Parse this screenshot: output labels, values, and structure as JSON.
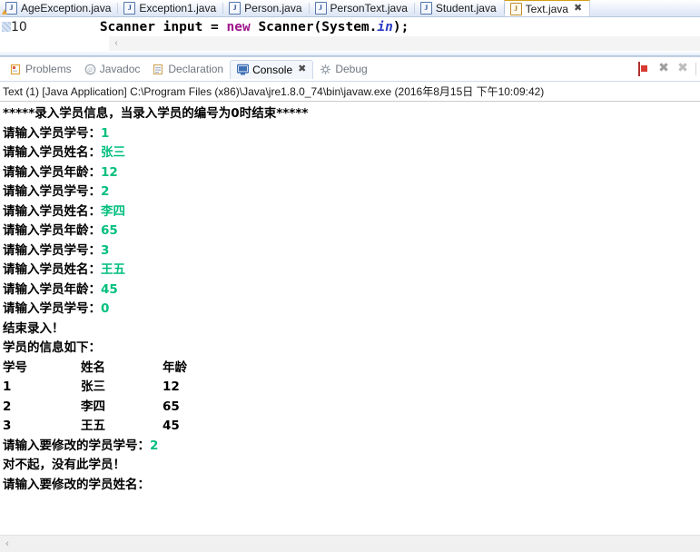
{
  "editor": {
    "tabs": [
      {
        "label": "AgeException.java",
        "icon": "java-file-warning-icon",
        "active": false,
        "warning": true
      },
      {
        "label": "Exception1.java",
        "icon": "java-file-icon",
        "active": false,
        "warning": false
      },
      {
        "label": "Person.java",
        "icon": "java-file-icon",
        "active": false,
        "warning": false
      },
      {
        "label": "PersonText.java",
        "icon": "java-file-icon",
        "active": false,
        "warning": false
      },
      {
        "label": "Student.java",
        "icon": "java-file-icon",
        "active": false,
        "warning": false
      },
      {
        "label": "Text.java",
        "icon": "java-file-icon",
        "active": true,
        "warning": false
      }
    ],
    "close_glyph": "✖",
    "line_number": "10",
    "code": {
      "indent": "",
      "part1": "Scanner input = ",
      "keyword": "new",
      "part2": " Scanner(System.",
      "field": "in",
      "part3": ");"
    }
  },
  "view_tabs": [
    {
      "label": "Problems",
      "icon": "problems-icon",
      "active": false
    },
    {
      "label": "Javadoc",
      "icon": "javadoc-icon",
      "active": false
    },
    {
      "label": "Declaration",
      "icon": "declaration-icon",
      "active": false
    },
    {
      "label": "Console",
      "icon": "console-icon",
      "active": true
    },
    {
      "label": "Debug",
      "icon": "debug-icon",
      "active": false
    }
  ],
  "view_tab_close_glyph": "✖",
  "toolbar": {
    "terminate_label": "terminate-button",
    "remove_label": "✖",
    "remove_all_label": "✖"
  },
  "console": {
    "header": "Text (1) [Java Application] C:\\Program Files (x86)\\Java\\jre1.8.0_74\\bin\\javaw.exe (2016年8月15日 下午10:09:42)",
    "lines": [
      {
        "type": "plain",
        "text": "*****录入学员信息，当录入学员的编号为0时结束*****"
      },
      {
        "type": "prompt",
        "text": "请输入学员学号：",
        "value": "1"
      },
      {
        "type": "prompt",
        "text": "请输入学员姓名：",
        "value": "张三"
      },
      {
        "type": "prompt",
        "text": "请输入学员年龄：",
        "value": "12"
      },
      {
        "type": "prompt",
        "text": "请输入学员学号：",
        "value": "2"
      },
      {
        "type": "prompt",
        "text": "请输入学员姓名：",
        "value": "李四"
      },
      {
        "type": "prompt",
        "text": "请输入学员年龄：",
        "value": "65"
      },
      {
        "type": "prompt",
        "text": "请输入学员学号：",
        "value": "3"
      },
      {
        "type": "prompt",
        "text": "请输入学员姓名：",
        "value": "王五"
      },
      {
        "type": "prompt",
        "text": "请输入学员年龄：",
        "value": "45"
      },
      {
        "type": "prompt",
        "text": "请输入学员学号：",
        "value": "0"
      },
      {
        "type": "plain",
        "text": "结束录入！"
      },
      {
        "type": "plain",
        "text": "学员的信息如下："
      },
      {
        "type": "row",
        "c1": "学号",
        "c2": "姓名",
        "c3": "年龄"
      },
      {
        "type": "row",
        "c1": "1",
        "c2": "张三",
        "c3": "12"
      },
      {
        "type": "row",
        "c1": "2",
        "c2": "李四",
        "c3": "65"
      },
      {
        "type": "row",
        "c1": "3",
        "c2": "王五",
        "c3": "45"
      },
      {
        "type": "prompt",
        "text": "请输入要修改的学员学号：",
        "value": "2"
      },
      {
        "type": "plain",
        "text": "对不起，没有此学员！"
      },
      {
        "type": "prompt",
        "text": "请输入要修改的学员姓名：",
        "value": ""
      }
    ]
  },
  "scrollbar": {
    "left_arrow": "‹"
  },
  "colors": {
    "console_value_green": "#00bf7d",
    "keyword_purple": "#a0158b",
    "field_blue": "#2a3cc4",
    "terminate_red": "#d83a32"
  }
}
